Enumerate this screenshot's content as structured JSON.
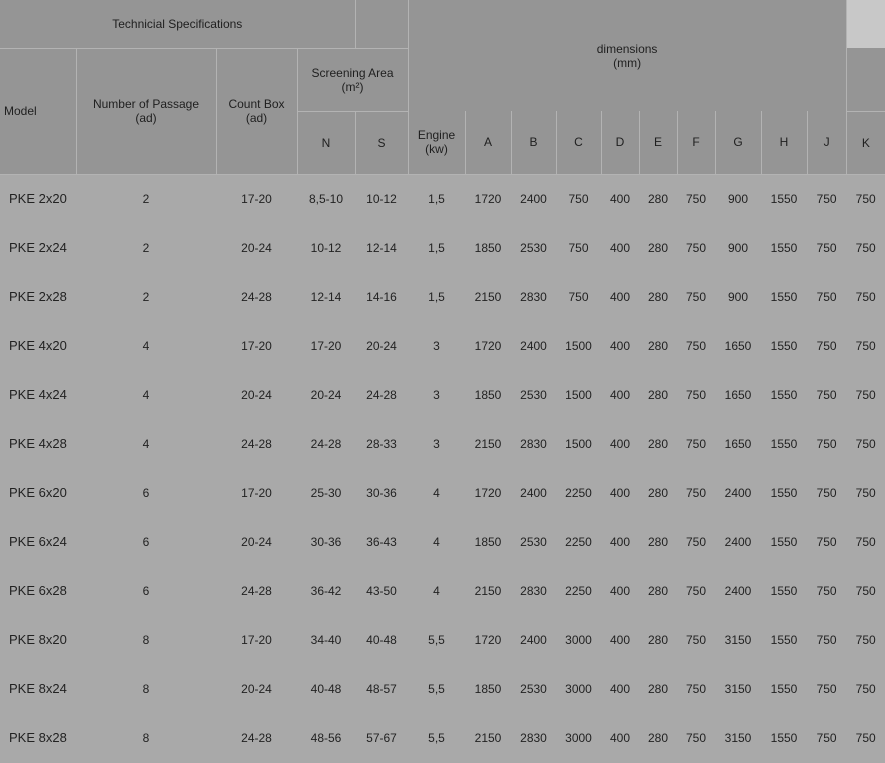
{
  "header": {
    "technical_specifications": "Technicial Specifications",
    "dimensions": "dimensions",
    "dimensions_unit": "(mm)",
    "model": "Model",
    "number_of_passage": "Number of Passage",
    "number_of_passage_unit": "(ad)",
    "count_box": "Count Box",
    "count_box_unit": "(ad)",
    "screening_area": "Screening Area",
    "screening_area_unit": "(m²)",
    "n": "N",
    "s": "S",
    "engine": "Engine",
    "engine_unit": "(kw)",
    "cols": [
      "A",
      "B",
      "C",
      "D",
      "E",
      "F",
      "G",
      "H",
      "J",
      "K"
    ]
  },
  "rows": [
    [
      "PKE 2x20",
      "2",
      "17-20",
      "8,5-10",
      "10-12",
      "1,5",
      "1720",
      "2400",
      "750",
      "400",
      "280",
      "750",
      "900",
      "1550",
      "750",
      "750"
    ],
    [
      "PKE 2x24",
      "2",
      "20-24",
      "10-12",
      "12-14",
      "1,5",
      "1850",
      "2530",
      "750",
      "400",
      "280",
      "750",
      "900",
      "1550",
      "750",
      "750"
    ],
    [
      "PKE 2x28",
      "2",
      "24-28",
      "12-14",
      "14-16",
      "1,5",
      "2150",
      "2830",
      "750",
      "400",
      "280",
      "750",
      "900",
      "1550",
      "750",
      "750"
    ],
    [
      "PKE 4x20",
      "4",
      "17-20",
      "17-20",
      "20-24",
      "3",
      "1720",
      "2400",
      "1500",
      "400",
      "280",
      "750",
      "1650",
      "1550",
      "750",
      "750"
    ],
    [
      "PKE 4x24",
      "4",
      "20-24",
      "20-24",
      "24-28",
      "3",
      "1850",
      "2530",
      "1500",
      "400",
      "280",
      "750",
      "1650",
      "1550",
      "750",
      "750"
    ],
    [
      "PKE 4x28",
      "4",
      "24-28",
      "24-28",
      "28-33",
      "3",
      "2150",
      "2830",
      "1500",
      "400",
      "280",
      "750",
      "1650",
      "1550",
      "750",
      "750"
    ],
    [
      "PKE 6x20",
      "6",
      "17-20",
      "25-30",
      "30-36",
      "4",
      "1720",
      "2400",
      "2250",
      "400",
      "280",
      "750",
      "2400",
      "1550",
      "750",
      "750"
    ],
    [
      "PKE 6x24",
      "6",
      "20-24",
      "30-36",
      "36-43",
      "4",
      "1850",
      "2530",
      "2250",
      "400",
      "280",
      "750",
      "2400",
      "1550",
      "750",
      "750"
    ],
    [
      "PKE 6x28",
      "6",
      "24-28",
      "36-42",
      "43-50",
      "4",
      "2150",
      "2830",
      "2250",
      "400",
      "280",
      "750",
      "2400",
      "1550",
      "750",
      "750"
    ],
    [
      "PKE 8x20",
      "8",
      "17-20",
      "34-40",
      "40-48",
      "5,5",
      "1720",
      "2400",
      "3000",
      "400",
      "280",
      "750",
      "3150",
      "1550",
      "750",
      "750"
    ],
    [
      "PKE 8x24",
      "8",
      "20-24",
      "40-48",
      "48-57",
      "5,5",
      "1850",
      "2530",
      "3000",
      "400",
      "280",
      "750",
      "3150",
      "1550",
      "750",
      "750"
    ],
    [
      "PKE 8x28",
      "8",
      "24-28",
      "48-56",
      "57-67",
      "5,5",
      "2150",
      "2830",
      "3000",
      "400",
      "280",
      "750",
      "3150",
      "1550",
      "750",
      "750"
    ]
  ]
}
